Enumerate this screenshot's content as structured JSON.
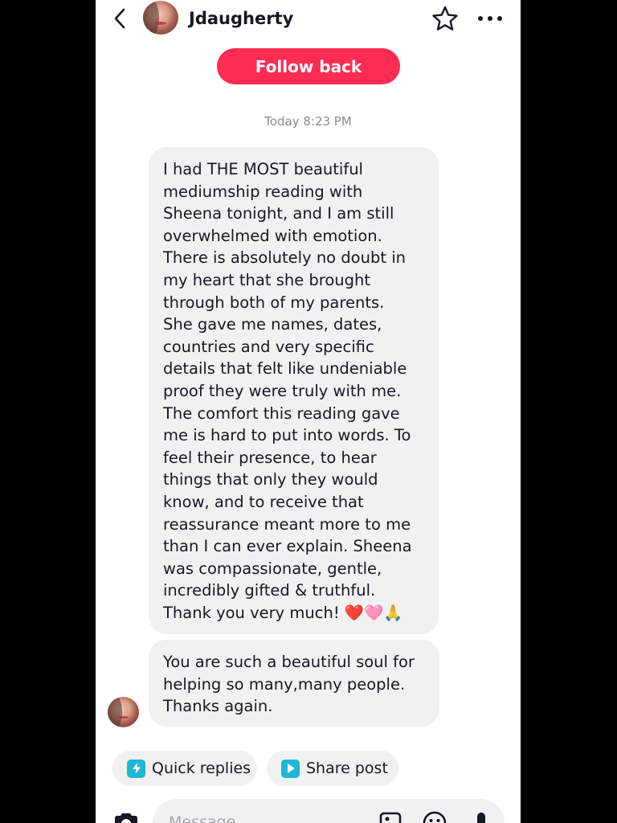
{
  "header": {
    "username": "Jdaugherty",
    "back_icon": "back-arrow-icon",
    "favorite_icon": "star-icon",
    "more_icon": "more-icon"
  },
  "follow_button": {
    "label": "Follow back",
    "color": "#fe2c55"
  },
  "timestamp": "Today 8:23 PM",
  "messages": [
    {
      "lines": [
        "I had THE MOST beautiful",
        "mediumship reading with",
        "Sheena tonight, and I am still",
        "overwhelmed with emotion.",
        "There is absolutely no doubt in",
        "my heart that she brought",
        "through both of my parents.",
        "She gave me names, dates,",
        "countries and very specific",
        "details that felt like undeniable",
        "proof they were truly with me.",
        "The comfort this reading gave",
        "me is hard to put into words. To",
        "feel their presence, to hear",
        "things that only they would",
        "know, and to receive that",
        "reassurance meant more to me",
        "than I can ever explain. Sheena",
        "was compassionate, gentle,",
        "incredibly gifted & truthful.",
        "Thank you very much! ❤️🩷🙏"
      ]
    },
    {
      "lines": [
        "You are such a beautiful soul for",
        "helping so many,many people.",
        "Thanks again."
      ]
    }
  ],
  "quick_actions": {
    "quick_replies": "Quick replies",
    "share_post": "Share post"
  },
  "composer": {
    "placeholder": "Message",
    "icons": [
      "camera-icon",
      "image-icon",
      "emoji-icon",
      "mic-icon"
    ]
  },
  "colors": {
    "accent": "#fe2c55",
    "bubble": "#f1f1f2",
    "chip_icon": "#20b6d6"
  }
}
